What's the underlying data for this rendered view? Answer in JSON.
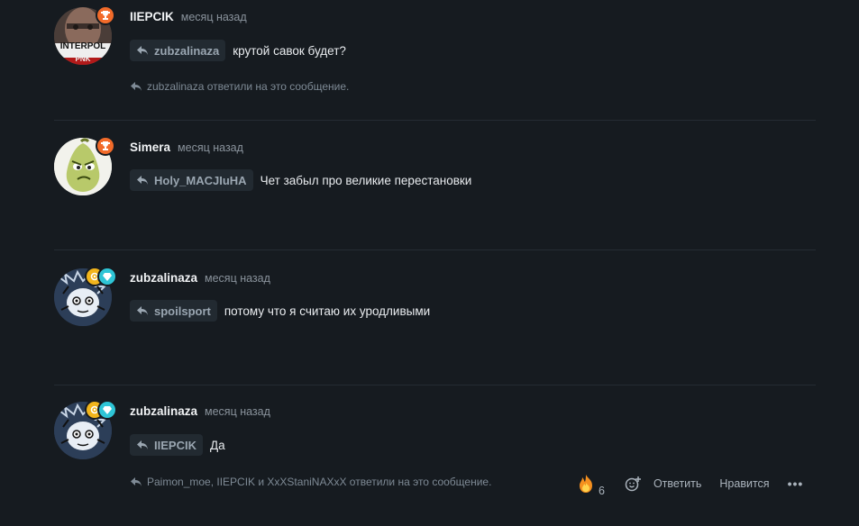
{
  "comments": [
    {
      "author": "IIEPCIK",
      "time": "месяц назад",
      "reply_to": "zubzalinaza",
      "text": "крутой савок будет?",
      "replies_note": "zubzalinaza ответили на это сообщение.",
      "avatar_text_top": "INTERPOL",
      "avatar_text_bottom": "PNK",
      "badge_icon": "trophy-icon"
    },
    {
      "author": "Simera",
      "time": "месяц назад",
      "reply_to": "Holy_MACJIuHA",
      "text": "Чет забыл про великие перестановки",
      "badge_icon": "trophy-icon"
    },
    {
      "author": "zubzalinaza",
      "time": "месяц назад",
      "reply_to": "spoilsport",
      "text": "потому что я считаю их уродливыми",
      "badge_icons": [
        "medal-icon",
        "diamond-icon"
      ]
    },
    {
      "author": "zubzalinaza",
      "time": "месяц назад",
      "reply_to": "IIEPCIK",
      "text": "Да",
      "replies_note": "Paimon_moe, IIEPCIK и XxXStaniNAXxX ответили на это сообщение.",
      "badge_icons": [
        "medal-icon",
        "diamond-icon"
      ]
    }
  ],
  "actions": {
    "reaction_emoji": "fire-icon",
    "reaction_count": "6",
    "add_reaction_icon": "add-reaction-icon",
    "reply_label": "Ответить",
    "like_label": "Нравится",
    "more_label": "•••"
  },
  "colors": {
    "background": "#161b20",
    "chip": "#222a31",
    "trophy_badge": "#f26b2a",
    "diamond_badge": "#2ec5d6",
    "medal_badge": "#f2b51c"
  }
}
